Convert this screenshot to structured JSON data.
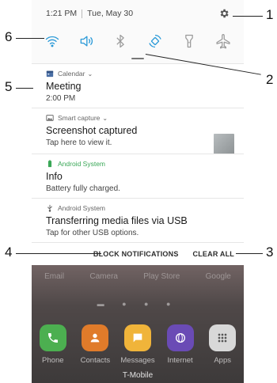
{
  "status_bar": {
    "time": "1:21 PM",
    "date": "Tue, May 30"
  },
  "quick_settings": [
    {
      "name": "wifi-icon",
      "active": true
    },
    {
      "name": "sound-icon",
      "active": true
    },
    {
      "name": "bluetooth-icon",
      "active": false
    },
    {
      "name": "auto-rotate-icon",
      "active": true
    },
    {
      "name": "flashlight-icon",
      "active": false
    },
    {
      "name": "airplane-icon",
      "active": false
    }
  ],
  "notifications": [
    {
      "app": "Calendar",
      "title": "Meeting",
      "sub": "2:00 PM",
      "expandable": true
    },
    {
      "app": "Smart capture",
      "title": "Screenshot captured",
      "sub": "Tap here to view it.",
      "expandable": true
    },
    {
      "app": "Android System",
      "title": "Info",
      "sub": "Battery fully charged.",
      "expandable": false
    },
    {
      "app": "Android System",
      "title": "Transferring media files via USB",
      "sub": "Tap for other USB options.",
      "expandable": false
    }
  ],
  "actions": {
    "block": "BLOCK NOTIFICATIONS",
    "clear": "CLEAR ALL"
  },
  "home": {
    "blurred_labels": [
      "Email",
      "Camera",
      "Play Store",
      "Google"
    ],
    "dock": [
      {
        "label": "Phone",
        "icon": "phone-icon",
        "color": "#4caf50"
      },
      {
        "label": "Contacts",
        "icon": "contacts-icon",
        "color": "#e07b2a"
      },
      {
        "label": "Messages",
        "icon": "messages-icon",
        "color": "#f0b43a"
      },
      {
        "label": "Internet",
        "icon": "internet-icon",
        "color": "#6a4bb5"
      },
      {
        "label": "Apps",
        "icon": "apps-icon",
        "color": "#d8d8d8"
      }
    ],
    "carrier": "T-Mobile"
  },
  "callouts": [
    "1",
    "2",
    "3",
    "4",
    "5",
    "6"
  ],
  "colors": {
    "accent": "#2b9ad8",
    "android_green": "#3aa757"
  }
}
